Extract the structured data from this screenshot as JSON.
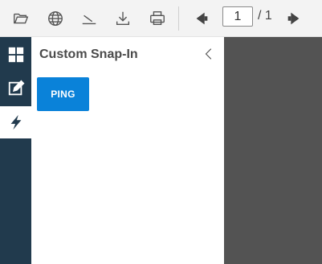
{
  "toolbar": {
    "icons": [
      "open-folder-icon",
      "globe-icon",
      "sign-icon",
      "download-icon",
      "print-icon",
      "previous-page-icon",
      "next-page-icon"
    ],
    "page_current": "1",
    "page_total": "/ 1"
  },
  "iconbar": {
    "items": [
      "grid-icon",
      "edit-icon",
      "lightning-icon"
    ],
    "active": "lightning-icon",
    "background": "#213a4d"
  },
  "panel": {
    "title": "Custom Snap-In",
    "collapse_icon": "chevron-left-icon",
    "ping_label": "PING",
    "button_color": "#0a82d9"
  },
  "viewer": {
    "background": "#535353"
  }
}
